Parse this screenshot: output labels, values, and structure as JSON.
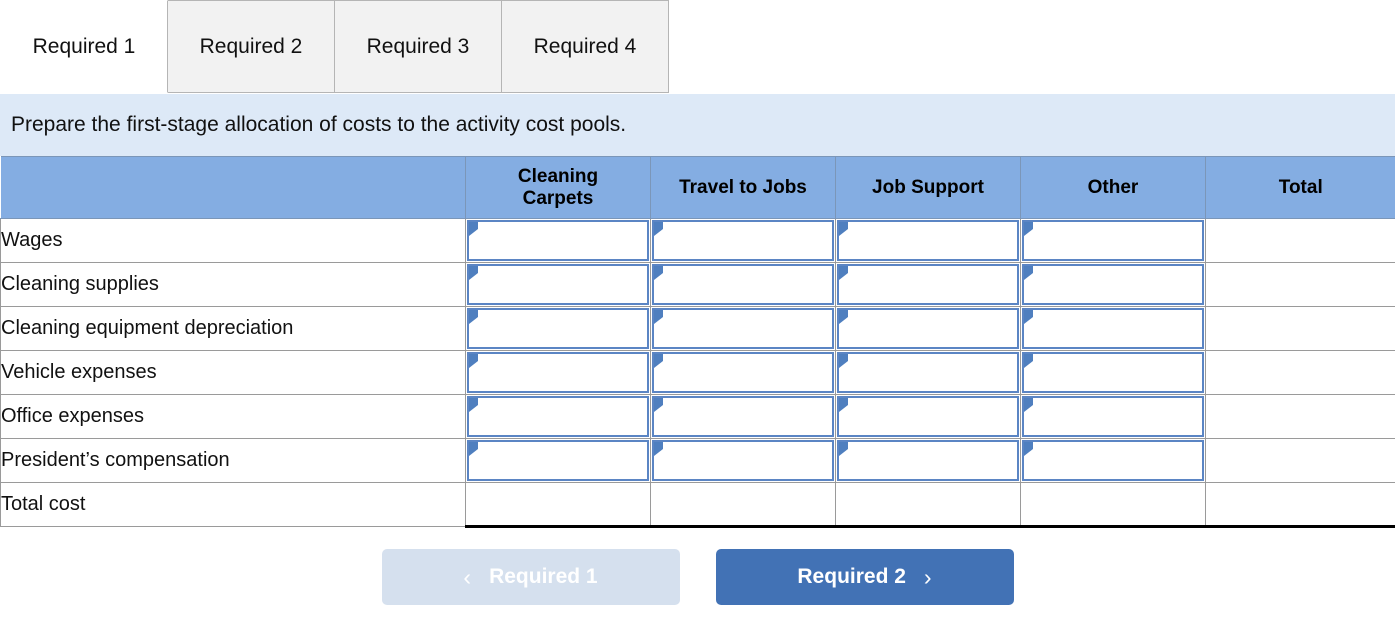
{
  "tabs": [
    {
      "label": "Required 1",
      "active": true
    },
    {
      "label": "Required 2",
      "active": false
    },
    {
      "label": "Required 3",
      "active": false
    },
    {
      "label": "Required 4",
      "active": false
    }
  ],
  "banner": {
    "text": "Prepare the first-stage allocation of costs to the activity cost pools."
  },
  "table": {
    "columns": [
      "",
      "Cleaning Carpets",
      "Travel to Jobs",
      "Job Support",
      "Other",
      "Total"
    ],
    "column_line1": [
      "",
      "Cleaning",
      "Travel to Jobs",
      "Job Support",
      "Other",
      "Total"
    ],
    "column_line2": [
      "",
      "Carpets",
      "",
      "",
      "",
      ""
    ],
    "rows": [
      {
        "label": "Wages",
        "cells": [
          "",
          "",
          "",
          ""
        ],
        "total": "",
        "editable": true
      },
      {
        "label": "Cleaning supplies",
        "cells": [
          "",
          "",
          "",
          ""
        ],
        "total": "",
        "editable": true
      },
      {
        "label": "Cleaning equipment depreciation",
        "cells": [
          "",
          "",
          "",
          ""
        ],
        "total": "",
        "editable": true
      },
      {
        "label": "Vehicle expenses",
        "cells": [
          "",
          "",
          "",
          ""
        ],
        "total": "",
        "editable": true
      },
      {
        "label": "Office expenses",
        "cells": [
          "",
          "",
          "",
          ""
        ],
        "total": "",
        "editable": true
      },
      {
        "label": "President’s compensation",
        "cells": [
          "",
          "",
          "",
          ""
        ],
        "total": "",
        "editable": true
      },
      {
        "label": "Total cost",
        "cells": [
          "",
          "",
          "",
          ""
        ],
        "total": "",
        "editable": false
      }
    ]
  },
  "footer": {
    "prev_label": "Required 1",
    "prev_chevron": "‹",
    "next_label": "Required 2",
    "next_chevron": "›"
  },
  "colors": {
    "header_blue": "#84ade2",
    "banner_blue": "#dde9f7",
    "input_border": "#5b85c4",
    "button_blue": "#4272b5",
    "button_disabled": "#d5e0ee"
  }
}
